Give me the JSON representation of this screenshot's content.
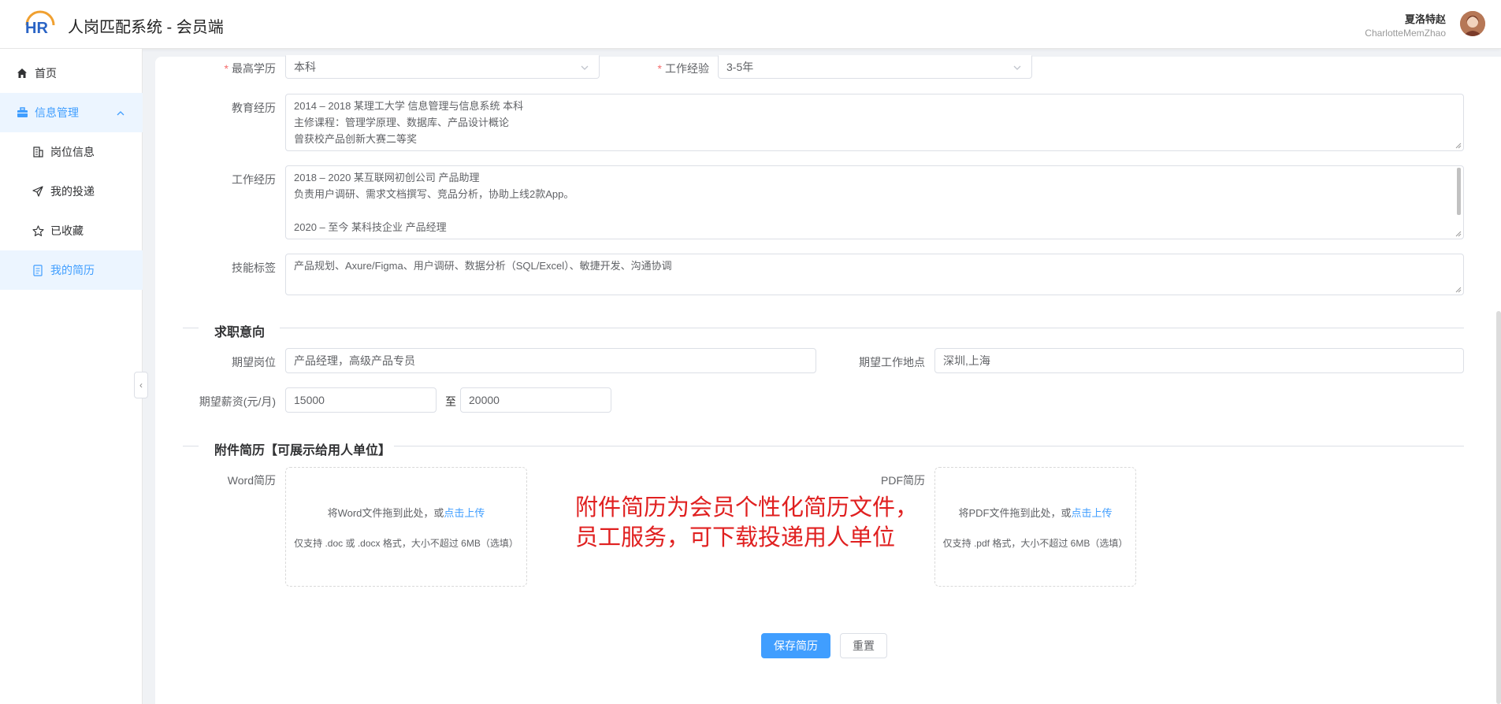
{
  "header": {
    "app_title": "人岗匹配系统 - 会员端",
    "logo_text": "HR",
    "user_name": "夏洛特赵",
    "user_account": "CharlotteMemZhao"
  },
  "sidebar": {
    "items": [
      {
        "label": "首页",
        "icon": "home-icon"
      },
      {
        "label": "信息管理",
        "icon": "briefcase-icon"
      },
      {
        "label": "岗位信息",
        "icon": "building-icon"
      },
      {
        "label": "我的投递",
        "icon": "send-icon"
      },
      {
        "label": "已收藏",
        "icon": "star-icon"
      },
      {
        "label": "我的简历",
        "icon": "document-icon"
      }
    ],
    "collapse_glyph": "‹"
  },
  "form": {
    "education_label": "最高学历",
    "education_value": "本科",
    "experience_label": "工作经验",
    "experience_value": "3-5年",
    "edu_history_label": "教育经历",
    "edu_history_lines": [
      "2014 – 2018 某理工大学 信息管理与信息系统 本科",
      "主修课程：管理学原理、数据库、产品设计概论",
      "曾获校产品创新大赛二等奖"
    ],
    "work_history_label": "工作经历",
    "work_history_lines": [
      "2018 – 2020 某互联网初创公司 产品助理",
      "负责用户调研、需求文档撰写、竞品分析，协助上线2款App。",
      "",
      "2020 – 至今 某科技企业 产品经理"
    ],
    "skills_label": "技能标签",
    "skills_value": "产品规划、Axure/Figma、用户调研、数据分析（SQL/Excel）、敏捷开发、沟通协调"
  },
  "intent": {
    "section_title": "求职意向",
    "position_label": "期望岗位",
    "position_value": "产品经理，高级产品专员",
    "location_label": "期望工作地点",
    "location_value": "深圳,上海",
    "salary_label": "期望薪资(元/月)",
    "salary_min": "15000",
    "salary_sep": "至",
    "salary_max": "20000"
  },
  "attachments": {
    "section_title": "附件简历【可展示给用人单位】",
    "word_label": "Word简历",
    "word_text": "将Word文件拖到此处，或",
    "word_link": "点击上传",
    "word_tip": "仅支持 .doc 或 .docx 格式，大小不超过 6MB（选填）",
    "pdf_label": "PDF简历",
    "pdf_text": "将PDF文件拖到此处，或",
    "pdf_link": "点击上传",
    "pdf_tip": "仅支持 .pdf 格式，大小不超过 6MB（选填）",
    "note_line1": "附件简历为会员个性化简历文件，",
    "note_line2": "员工服务，可下载投递用人单位"
  },
  "actions": {
    "save_label": "保存简历",
    "reset_label": "重置"
  },
  "colors": {
    "primary": "#409eff",
    "required": "#f56c6c",
    "note": "#e02020"
  }
}
